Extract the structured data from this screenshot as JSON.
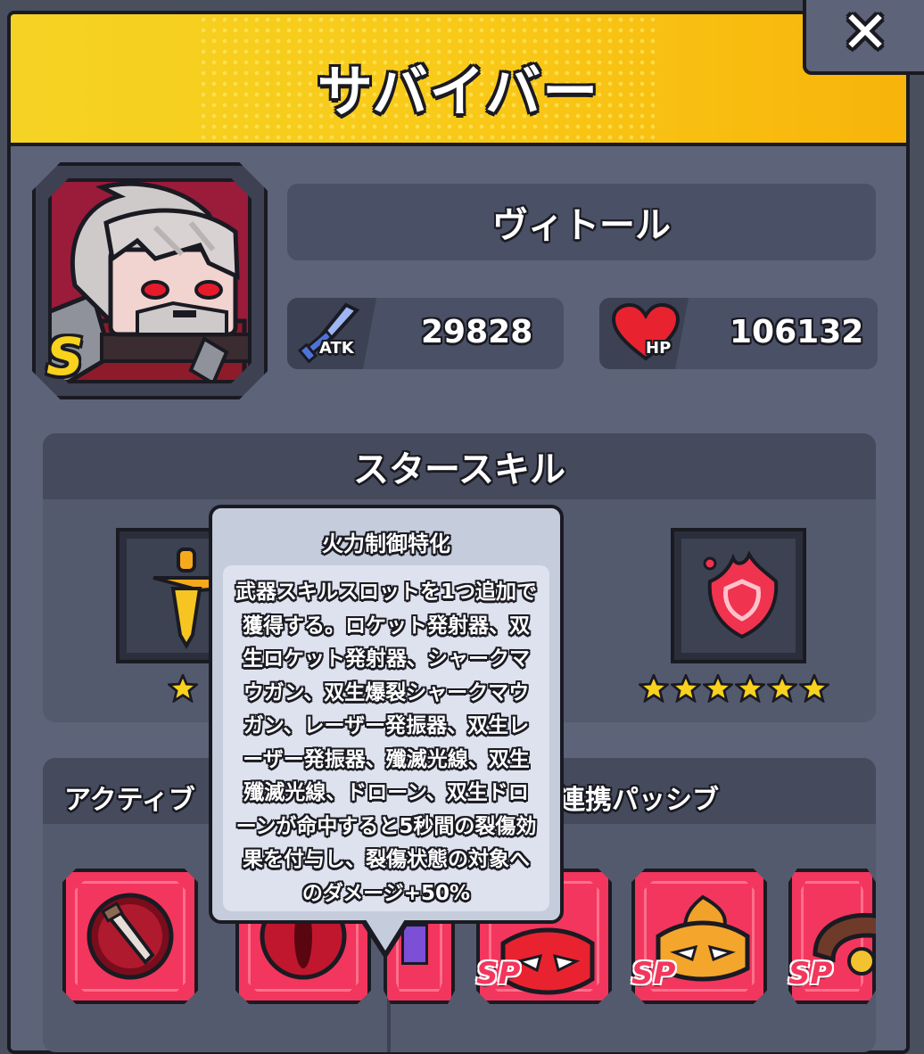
{
  "header": {
    "title": "サバイバー"
  },
  "close_button": {
    "label": "✕"
  },
  "character": {
    "rank": "S",
    "name": "ヴィトール",
    "atk_label": "ATK",
    "atk_value": "29828",
    "hp_label": "HP",
    "hp_value": "106132"
  },
  "star_skill": {
    "heading": "スタースキル",
    "left_slot": {
      "icon": "dagger-icon",
      "stars": 1
    },
    "right_slot": {
      "icon": "fire-shield-icon",
      "stars": 6
    }
  },
  "tooltip": {
    "title": "火力制御特化",
    "body": "武器スキルスロットを1つ追加で獲得する。ロケット発射器、双生ロケット発射器、シャークマウガン、双生爆裂シャークマウガン、レーザー発振器、双生レーザー発振器、殲滅光線、双生殲滅光線、ドローン、双生ドローンが命中すると5秒間の裂傷効果を付与し、裂傷状態の対象へのダメージ+50%"
  },
  "skills_section": {
    "active_label": "アクティブ",
    "passive_label": "連携パッシブ",
    "icons": [
      {
        "icon": "dagger-orb-icon",
        "sp": false
      },
      {
        "icon": "red-eye-icon",
        "sp": false
      },
      {
        "icon": "purple-item-icon",
        "sp": false
      },
      {
        "icon": "red-mask-icon",
        "sp": true,
        "sp_label": "SP"
      },
      {
        "icon": "orange-mask-icon",
        "sp": true,
        "sp_label": "SP"
      },
      {
        "icon": "collar-icon",
        "sp": true,
        "sp_label": "SP"
      }
    ]
  },
  "colors": {
    "header_yellow": "#f9c817",
    "panel_bg": "#5d6378",
    "skill_pink": "#f2365d",
    "star_gold": "#f8d21c"
  }
}
